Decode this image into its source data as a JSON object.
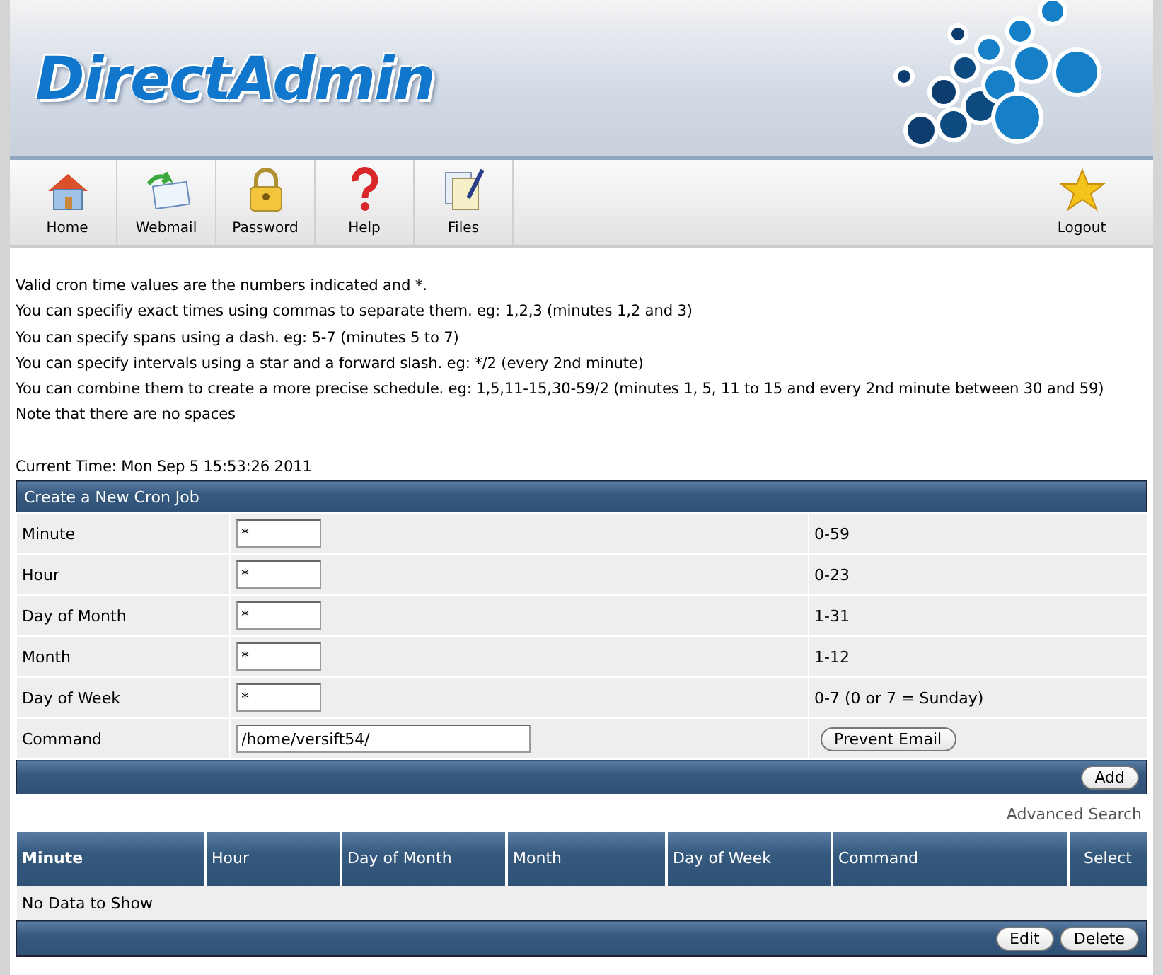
{
  "header": {
    "logo": "DirectAdmin"
  },
  "toolbar": [
    {
      "label": "Home"
    },
    {
      "label": "Webmail"
    },
    {
      "label": "Password"
    },
    {
      "label": "Help"
    },
    {
      "label": "Files"
    }
  ],
  "logout": {
    "label": "Logout"
  },
  "notes": [
    "Valid cron time values are the numbers indicated and *.",
    "You can specifiy exact times using commas to separate them. eg: 1,2,3 (minutes 1,2 and 3)",
    "You can specify spans using a dash. eg: 5-7 (minutes 5 to 7)",
    "You can specify intervals using a star and a forward slash. eg: */2 (every 2nd minute)",
    "You can combine them to create a more precise schedule. eg: 1,5,11-15,30-59/2 (minutes 1, 5, 11 to 15 and every 2nd minute between 30 and 59)",
    "Note that there are no spaces"
  ],
  "current_time": "Current Time: Mon Sep 5 15:53:26 2011",
  "form": {
    "title": "Create a New Cron Job",
    "rows": [
      {
        "label": "Minute",
        "value": "*",
        "hint": "0-59",
        "kind": "short"
      },
      {
        "label": "Hour",
        "value": "*",
        "hint": "0-23",
        "kind": "short"
      },
      {
        "label": "Day of Month",
        "value": "*",
        "hint": "1-31",
        "kind": "short"
      },
      {
        "label": "Month",
        "value": "*",
        "hint": "1-12",
        "kind": "short"
      },
      {
        "label": "Day of Week",
        "value": "*",
        "hint": "0-7 (0 or 7 = Sunday)",
        "kind": "short"
      },
      {
        "label": "Command",
        "value": "/home/versift54/",
        "button": "Prevent Email",
        "kind": "long"
      }
    ],
    "submit": "Add"
  },
  "advanced_search": "Advanced Search",
  "table": {
    "columns": [
      {
        "label": "Minute",
        "sorted": true
      },
      {
        "label": "Hour",
        "sorted": false
      },
      {
        "label": "Day of Month",
        "sorted": false
      },
      {
        "label": "Month",
        "sorted": false
      },
      {
        "label": "Day of Week",
        "sorted": false
      },
      {
        "label": "Command",
        "sorted": false
      },
      {
        "label": "Select",
        "sorted": false
      }
    ],
    "empty": "No Data to Show",
    "buttons": [
      "Edit",
      "Delete"
    ]
  }
}
